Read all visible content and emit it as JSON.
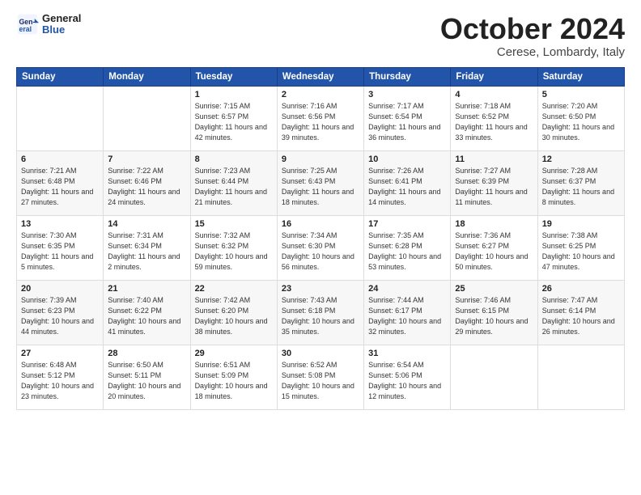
{
  "logo": {
    "line1": "General",
    "line2": "Blue"
  },
  "title": "October 2024",
  "subtitle": "Cerese, Lombardy, Italy",
  "weekdays": [
    "Sunday",
    "Monday",
    "Tuesday",
    "Wednesday",
    "Thursday",
    "Friday",
    "Saturday"
  ],
  "weeks": [
    [
      {
        "day": "",
        "info": ""
      },
      {
        "day": "",
        "info": ""
      },
      {
        "day": "1",
        "info": "Sunrise: 7:15 AM\nSunset: 6:57 PM\nDaylight: 11 hours and 42 minutes."
      },
      {
        "day": "2",
        "info": "Sunrise: 7:16 AM\nSunset: 6:56 PM\nDaylight: 11 hours and 39 minutes."
      },
      {
        "day": "3",
        "info": "Sunrise: 7:17 AM\nSunset: 6:54 PM\nDaylight: 11 hours and 36 minutes."
      },
      {
        "day": "4",
        "info": "Sunrise: 7:18 AM\nSunset: 6:52 PM\nDaylight: 11 hours and 33 minutes."
      },
      {
        "day": "5",
        "info": "Sunrise: 7:20 AM\nSunset: 6:50 PM\nDaylight: 11 hours and 30 minutes."
      }
    ],
    [
      {
        "day": "6",
        "info": "Sunrise: 7:21 AM\nSunset: 6:48 PM\nDaylight: 11 hours and 27 minutes."
      },
      {
        "day": "7",
        "info": "Sunrise: 7:22 AM\nSunset: 6:46 PM\nDaylight: 11 hours and 24 minutes."
      },
      {
        "day": "8",
        "info": "Sunrise: 7:23 AM\nSunset: 6:44 PM\nDaylight: 11 hours and 21 minutes."
      },
      {
        "day": "9",
        "info": "Sunrise: 7:25 AM\nSunset: 6:43 PM\nDaylight: 11 hours and 18 minutes."
      },
      {
        "day": "10",
        "info": "Sunrise: 7:26 AM\nSunset: 6:41 PM\nDaylight: 11 hours and 14 minutes."
      },
      {
        "day": "11",
        "info": "Sunrise: 7:27 AM\nSunset: 6:39 PM\nDaylight: 11 hours and 11 minutes."
      },
      {
        "day": "12",
        "info": "Sunrise: 7:28 AM\nSunset: 6:37 PM\nDaylight: 11 hours and 8 minutes."
      }
    ],
    [
      {
        "day": "13",
        "info": "Sunrise: 7:30 AM\nSunset: 6:35 PM\nDaylight: 11 hours and 5 minutes."
      },
      {
        "day": "14",
        "info": "Sunrise: 7:31 AM\nSunset: 6:34 PM\nDaylight: 11 hours and 2 minutes."
      },
      {
        "day": "15",
        "info": "Sunrise: 7:32 AM\nSunset: 6:32 PM\nDaylight: 10 hours and 59 minutes."
      },
      {
        "day": "16",
        "info": "Sunrise: 7:34 AM\nSunset: 6:30 PM\nDaylight: 10 hours and 56 minutes."
      },
      {
        "day": "17",
        "info": "Sunrise: 7:35 AM\nSunset: 6:28 PM\nDaylight: 10 hours and 53 minutes."
      },
      {
        "day": "18",
        "info": "Sunrise: 7:36 AM\nSunset: 6:27 PM\nDaylight: 10 hours and 50 minutes."
      },
      {
        "day": "19",
        "info": "Sunrise: 7:38 AM\nSunset: 6:25 PM\nDaylight: 10 hours and 47 minutes."
      }
    ],
    [
      {
        "day": "20",
        "info": "Sunrise: 7:39 AM\nSunset: 6:23 PM\nDaylight: 10 hours and 44 minutes."
      },
      {
        "day": "21",
        "info": "Sunrise: 7:40 AM\nSunset: 6:22 PM\nDaylight: 10 hours and 41 minutes."
      },
      {
        "day": "22",
        "info": "Sunrise: 7:42 AM\nSunset: 6:20 PM\nDaylight: 10 hours and 38 minutes."
      },
      {
        "day": "23",
        "info": "Sunrise: 7:43 AM\nSunset: 6:18 PM\nDaylight: 10 hours and 35 minutes."
      },
      {
        "day": "24",
        "info": "Sunrise: 7:44 AM\nSunset: 6:17 PM\nDaylight: 10 hours and 32 minutes."
      },
      {
        "day": "25",
        "info": "Sunrise: 7:46 AM\nSunset: 6:15 PM\nDaylight: 10 hours and 29 minutes."
      },
      {
        "day": "26",
        "info": "Sunrise: 7:47 AM\nSunset: 6:14 PM\nDaylight: 10 hours and 26 minutes."
      }
    ],
    [
      {
        "day": "27",
        "info": "Sunrise: 6:48 AM\nSunset: 5:12 PM\nDaylight: 10 hours and 23 minutes."
      },
      {
        "day": "28",
        "info": "Sunrise: 6:50 AM\nSunset: 5:11 PM\nDaylight: 10 hours and 20 minutes."
      },
      {
        "day": "29",
        "info": "Sunrise: 6:51 AM\nSunset: 5:09 PM\nDaylight: 10 hours and 18 minutes."
      },
      {
        "day": "30",
        "info": "Sunrise: 6:52 AM\nSunset: 5:08 PM\nDaylight: 10 hours and 15 minutes."
      },
      {
        "day": "31",
        "info": "Sunrise: 6:54 AM\nSunset: 5:06 PM\nDaylight: 10 hours and 12 minutes."
      },
      {
        "day": "",
        "info": ""
      },
      {
        "day": "",
        "info": ""
      }
    ]
  ]
}
